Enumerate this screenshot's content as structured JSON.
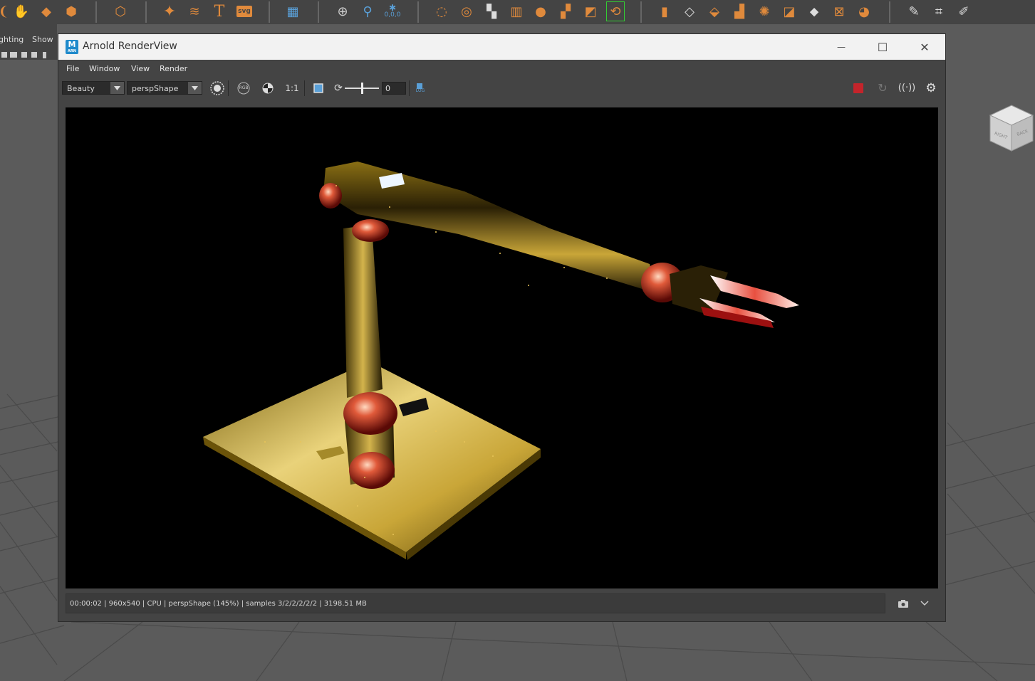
{
  "shelf": {
    "icons": [
      "lasso-icon",
      "paint-select-icon",
      "diamond-icon",
      "poly-shape-icon",
      "polyhedron-icon",
      "sparkle-icon",
      "sweep-icon",
      "text-icon",
      "svg-icon",
      "grid-icon",
      "pivot-icon",
      "zero-pivot-icon",
      "freeze-icon",
      "combine-icon",
      "separate-icon",
      "extract-icon",
      "boolean-icon",
      "mirror-icon",
      "smooth-icon",
      "bevel-icon",
      "bridge-icon",
      "extrude-icon",
      "fill-hole-icon",
      "uv-icon",
      "target-weld-icon",
      "cube-icon",
      "planar-icon",
      "merge-icon",
      "sphere-icon",
      "crease-icon",
      "layers-icon",
      "bounding-icon",
      "multicut-icon",
      "edit-mesh-icon",
      "sculpt-icon",
      "select-icon"
    ],
    "svg_label": "svg",
    "text_label": "T",
    "pivot_readout": "0,0,0"
  },
  "viewport": {
    "menu": {
      "lighting": "ghting",
      "show": "Show"
    },
    "viewcube": {
      "right_label": "RIGHT",
      "back_label": "BACK"
    }
  },
  "window": {
    "title": "Arnold RenderView",
    "logo": "M",
    "logo_sub": "ARN",
    "buttons": {
      "minimize": "—",
      "maximize": "☐",
      "close": "✕"
    }
  },
  "menu": [
    "File",
    "Window",
    "View",
    "Render"
  ],
  "toolbar": {
    "aov": "Beauty",
    "camera": "perspShape",
    "rgb_label": "RGB",
    "ratio_label": "1:1",
    "exposure": "0",
    "log_label": "LOG"
  },
  "colors": {
    "accent": "#e08a3c",
    "stop": "#c4242b",
    "window_bg": "#444444",
    "titlebar": "#f2f2f2"
  },
  "status": {
    "text": "00:00:02 | 960x540 | CPU | perspShape (145%) | samples 3/2/2/2/2/2 | 3198.51 MB"
  }
}
